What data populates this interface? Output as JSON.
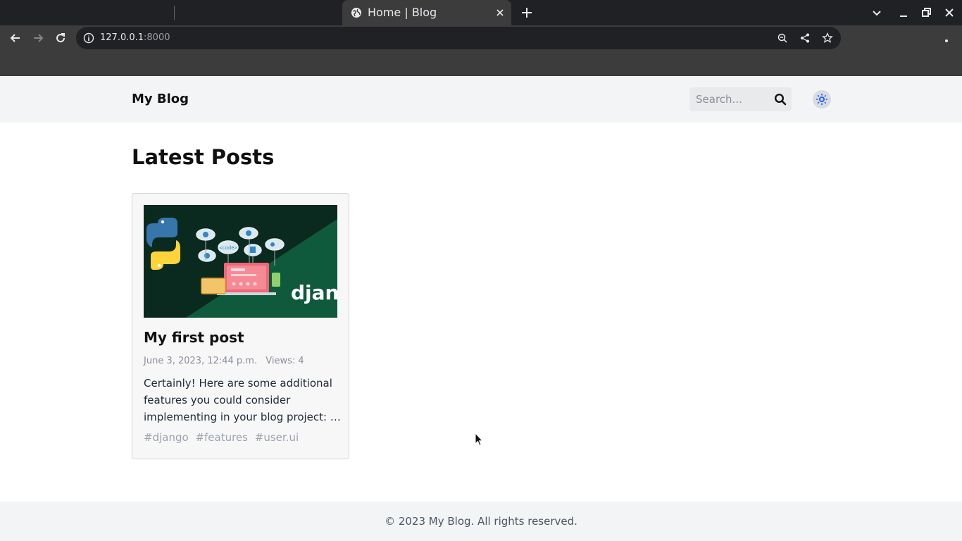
{
  "browser": {
    "tab": {
      "title": "Home | Blog",
      "icon": "globe-icon"
    },
    "address": {
      "host": "127.0.0.1",
      "port": ":8000"
    },
    "colors": {
      "tabbar": "#202124",
      "toolbar": "#3c3c3c",
      "active_tab": "#3c3c3c"
    }
  },
  "site": {
    "brand": "My Blog",
    "search": {
      "placeholder": "Search..."
    },
    "theme_toggle_icon": "sun-icon"
  },
  "main": {
    "heading": "Latest Posts",
    "posts": [
      {
        "title": "My first post",
        "date": "June 3, 2023, 12:44 p.m.",
        "views": "Views: 4",
        "excerpt": "Certainly! Here are some additional features you could consider implementing in your blog project: …",
        "tags": [
          "#django",
          "#features",
          "#user.ui"
        ],
        "thumbnail": {
          "logo_text": "djang",
          "code_tag": "<code>"
        }
      }
    ]
  },
  "footer": {
    "text": "© 2023 My Blog. All rights reserved."
  },
  "colors": {
    "accent": "#2563eb",
    "header_bg": "#f3f4f6",
    "thumb_dark": "#0c2a20",
    "thumb_green": "#0f5a3c"
  }
}
